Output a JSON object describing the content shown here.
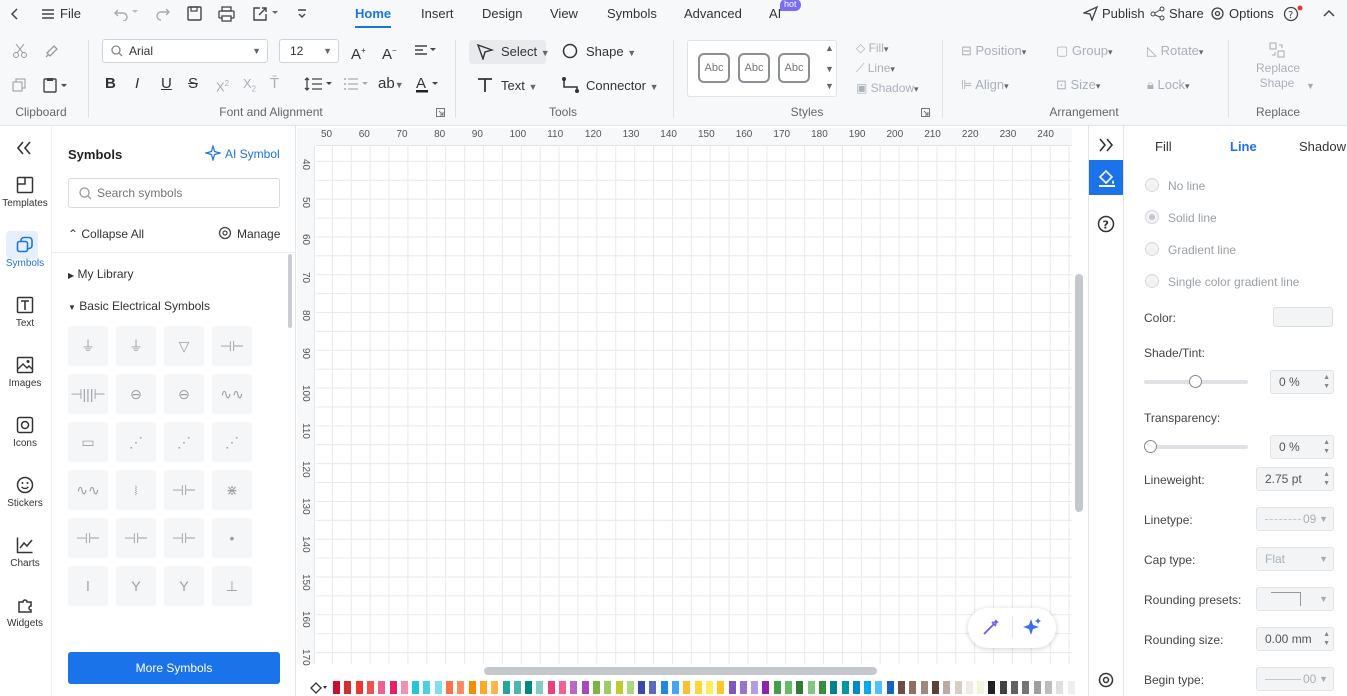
{
  "menu": {
    "file": "File",
    "publish": "Publish",
    "share": "Share",
    "options": "Options",
    "hot_badge": "hot"
  },
  "tabs": [
    "Home",
    "Insert",
    "Design",
    "View",
    "Symbols",
    "Advanced",
    "AI"
  ],
  "ribbon": {
    "font_name": "Arial",
    "font_size": "12",
    "select": "Select",
    "shape": "Shape",
    "text": "Text",
    "connector": "Connector",
    "abc": "Abc",
    "fill": "Fill",
    "line": "Line",
    "shadow": "Shadow",
    "position": "Position",
    "group": "Group",
    "rotate": "Rotate",
    "align": "Align",
    "size": "Size",
    "lock": "Lock",
    "replace_shape_1": "Replace",
    "replace_shape_2": "Shape",
    "groups": {
      "clipboard": "Clipboard",
      "font": "Font and Alignment",
      "tools": "Tools",
      "styles": "Styles",
      "arrangement": "Arrangement",
      "replace": "Replace"
    }
  },
  "leftbar": [
    "Templates",
    "Symbols",
    "Text",
    "Images",
    "Icons",
    "Stickers",
    "Charts",
    "Widgets"
  ],
  "symbols_panel": {
    "title": "Symbols",
    "ai_symbol": "AI Symbol",
    "search_placeholder": "Search symbols",
    "collapse_all": "Collapse All",
    "manage": "Manage",
    "my_library": "My Library",
    "basic_electrical": "Basic Electrical Symbols",
    "more_symbols": "More Symbols"
  },
  "ruler_top": [
    "50",
    "60",
    "70",
    "80",
    "90",
    "100",
    "110",
    "120",
    "130",
    "140",
    "150",
    "160",
    "170",
    "180",
    "190",
    "200",
    "210",
    "220",
    "230",
    "240"
  ],
  "ruler_left": [
    "40",
    "50",
    "60",
    "70",
    "80",
    "90",
    "100",
    "110",
    "120",
    "130",
    "140",
    "150",
    "160",
    "170"
  ],
  "right_panel": {
    "tabs": [
      "Fill",
      "Line",
      "Shadow"
    ],
    "line_options": [
      "No line",
      "Solid line",
      "Gradient line",
      "Single color gradient line"
    ],
    "color": "Color:",
    "shade": "Shade/Tint:",
    "shade_value": "0 %",
    "transparency": "Transparency:",
    "transparency_value": "0 %",
    "lineweight": "Lineweight:",
    "lineweight_value": "2.75 pt",
    "linetype": "Linetype:",
    "linetype_value": "09",
    "cap": "Cap type:",
    "cap_value": "Flat",
    "rounding_presets": "Rounding presets:",
    "rounding_size": "Rounding size:",
    "rounding_size_value": "0.00 mm",
    "begin_type": "Begin type:",
    "begin_type_value": "00"
  },
  "palette_colors": [
    "#c8102e",
    "#d32f2f",
    "#e53935",
    "#ef5350",
    "#f06292",
    "#e91e63",
    "#f48fb1",
    "#26c6da",
    "#4dd0e1",
    "#80deea",
    "#ff7043",
    "#ff8a65",
    "#fb8c00",
    "#ffa726",
    "#ffb74d",
    "#26a69a",
    "#4db6ac",
    "#00897b",
    "#80cbc4",
    "#ec407a",
    "#f06292",
    "#ba68c8",
    "#ab47bc",
    "#7cb342",
    "#9ccc65",
    "#c0ca33",
    "#aed581",
    "#3949ab",
    "#5c6bc0",
    "#1e88e5",
    "#42a5f5",
    "#fbc02d",
    "#fdd835",
    "#ffee58",
    "#ffca28",
    "#7e57c2",
    "#9575cd",
    "#b39ddb",
    "#8e24aa",
    "#43a047",
    "#66bb6a",
    "#2e7d32",
    "#81c784",
    "#388e3c",
    "#00838f",
    "#0097a7",
    "#0288d1",
    "#03a9f4",
    "#4fc3f7",
    "#1565c0",
    "#6d4c41",
    "#8d6e63",
    "#a1887f",
    "#5d4037",
    "#bcaaa4",
    "#d7ccc8",
    "#efebe9",
    "#f5f5dc",
    "#212121",
    "#424242",
    "#616161",
    "#757575",
    "#9e9e9e",
    "#bdbdbd",
    "#e0e0e0",
    "#eeeeee"
  ]
}
